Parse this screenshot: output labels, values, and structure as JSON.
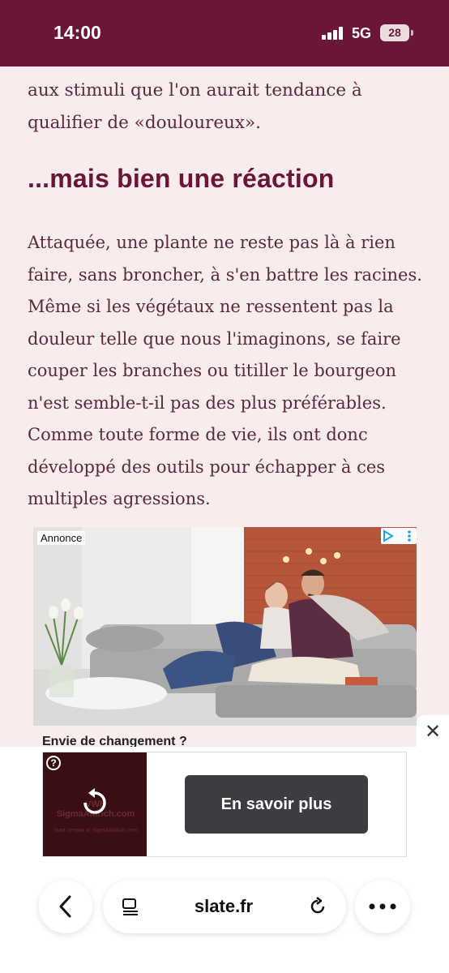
{
  "status_bar": {
    "time": "14:00",
    "network": "5G",
    "battery": "28"
  },
  "article": {
    "para_top": "aux stimuli que l'on aurait tendance à qualifier de «douloureux».",
    "heading": "...mais bien une réaction",
    "para_main": "Attaquée, une plante ne reste pas là à rien faire, sans broncher, à s'en battre les racines. Même si les végétaux ne ressentent pas la douleur telle que nous l'imaginons, se faire couper les branches ou titiller le bourgeon n'est semble-t-il pas des plus préférables. Comme toute forme de vie, ils ont donc développé des outils pour échapper à ces multiples agressions."
  },
  "ad": {
    "label": "Annonce",
    "caption": "Envie de changement ?",
    "icons": [
      "adchoices-icon",
      "more-vertical-icon"
    ]
  },
  "sticky_ad": {
    "close": "✕",
    "banner_text": "VWR SigmaAldrich.com",
    "banner_subtext": "Start certain at SigmaAldrich.com",
    "cta": "En savoir plus"
  },
  "browser": {
    "url": "slate.fr"
  }
}
